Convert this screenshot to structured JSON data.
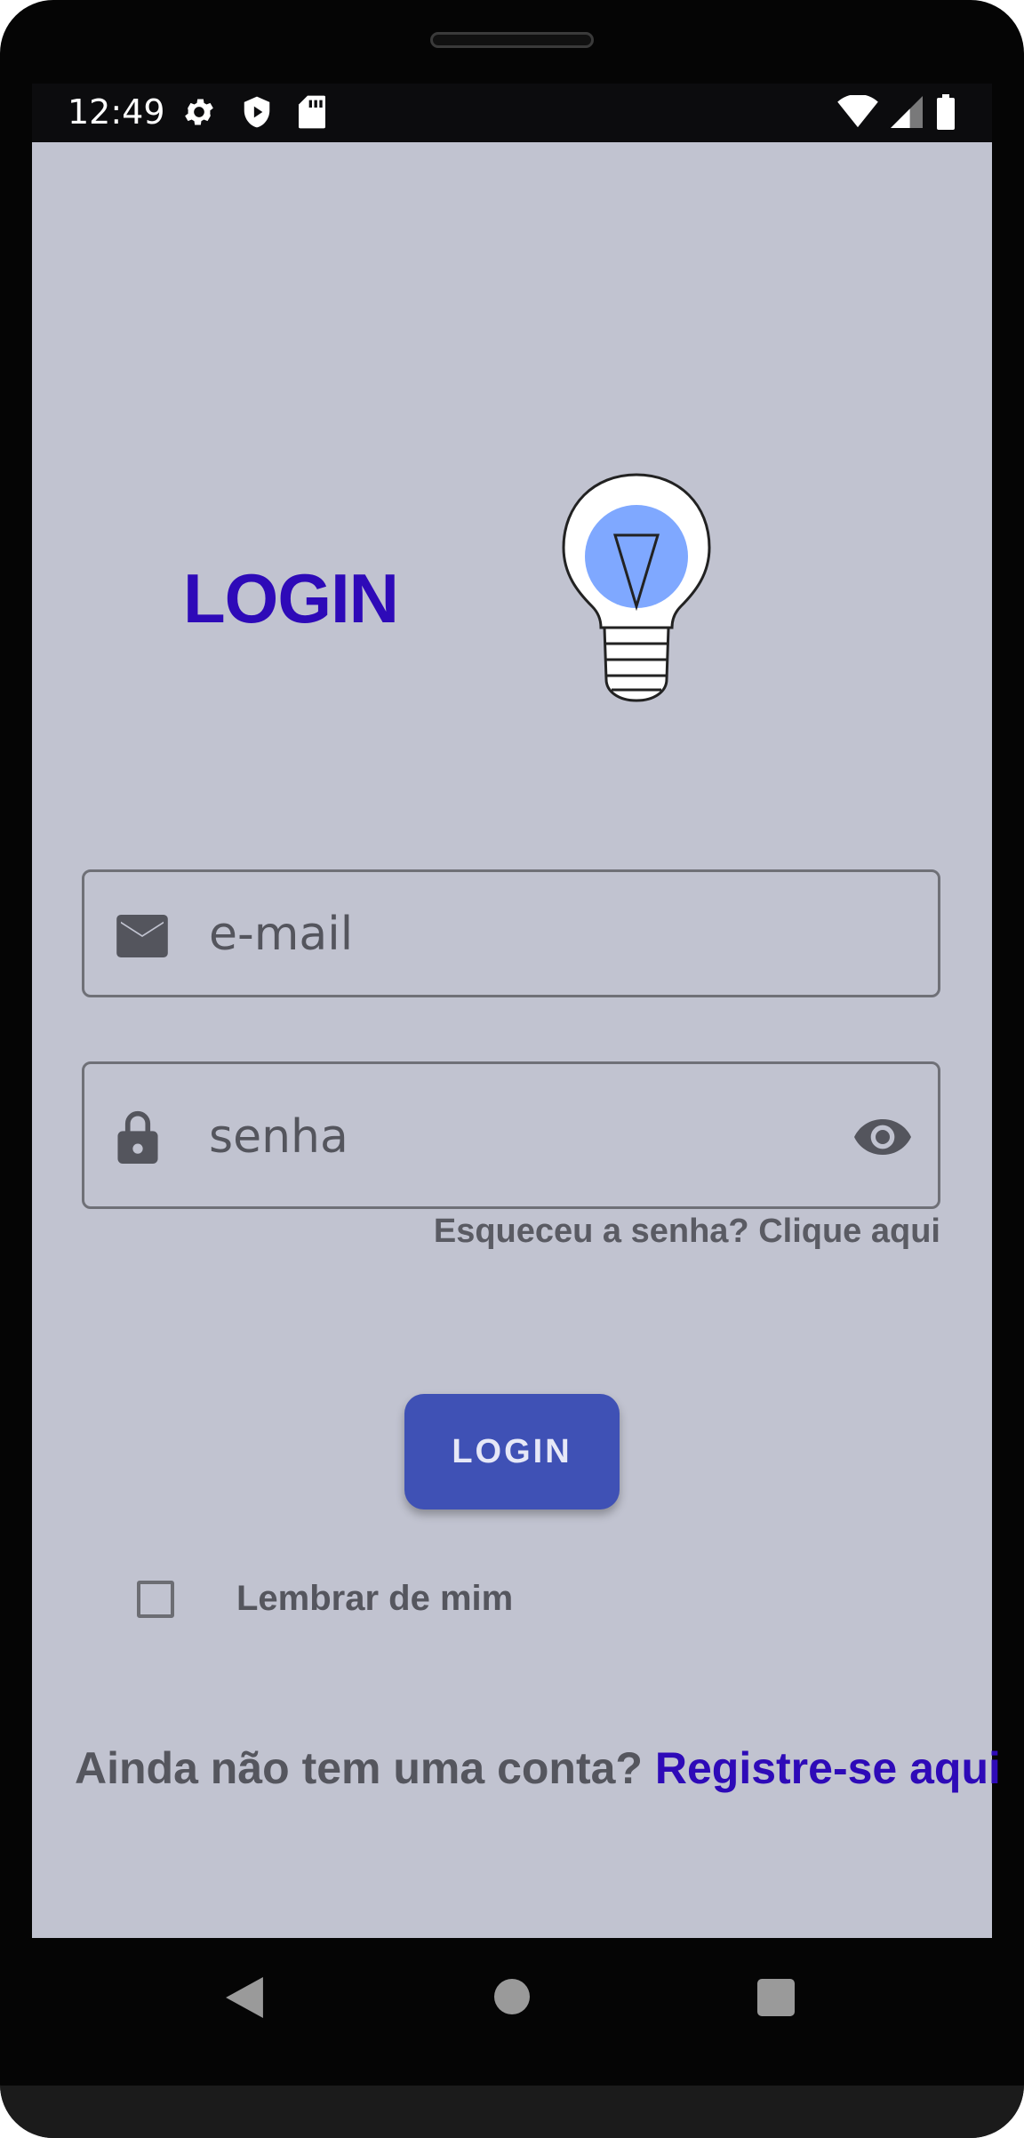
{
  "status_bar": {
    "time": "12:49",
    "left_icons": [
      "settings-icon",
      "shield-play-icon",
      "sd-card-icon"
    ],
    "right_icons": [
      "wifi-icon",
      "signal-icon",
      "battery-icon"
    ]
  },
  "login": {
    "title": "LOGIN",
    "illustration": "lightbulb-icon",
    "email": {
      "placeholder": "e-mail",
      "value": "",
      "icon": "email-icon"
    },
    "password": {
      "placeholder": "senha",
      "value": "",
      "icon": "lock-icon",
      "toggle_icon": "eye-icon"
    },
    "forgot_text": "Esqueceu a senha? Clique aqui",
    "button_label": "LOGIN",
    "remember_label": "Lembrar de mim",
    "remember_checked": false,
    "register_prompt": "Ainda não tem uma conta?",
    "register_link": "Registre-se aqui"
  },
  "nav_bar": {
    "buttons": [
      "back-icon",
      "home-icon",
      "recents-icon"
    ]
  },
  "colors": {
    "screen_background": "#c1c3d0",
    "accent": "#2e0ab8",
    "button": "#3f51b5",
    "bulb_glow": "#7fa8ff"
  }
}
